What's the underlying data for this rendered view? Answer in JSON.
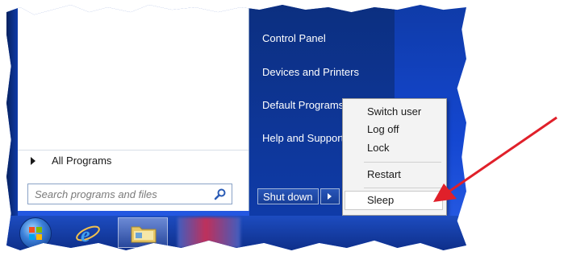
{
  "start_menu": {
    "left_pane": {
      "all_programs_label": "All Programs",
      "search_placeholder": "Search programs and files"
    },
    "right_pane": {
      "items": [
        {
          "label": "Control Panel"
        },
        {
          "label": "Devices and Printers"
        },
        {
          "label": "Default Programs"
        },
        {
          "label": "Help and Support"
        }
      ],
      "shutdown_label": "Shut down"
    }
  },
  "shutdown_submenu": {
    "items": [
      {
        "label": "Switch user"
      },
      {
        "label": "Log off"
      },
      {
        "label": "Lock"
      },
      {
        "label": "Restart"
      },
      {
        "label": "Sleep",
        "highlighted": true
      }
    ]
  },
  "taskbar": {
    "icons": [
      "windows-start-orb",
      "internet-explorer-icon",
      "windows-explorer-icon",
      "redacted-app"
    ]
  },
  "colors": {
    "start_menu_right": "#0f3ba8",
    "annotation_arrow": "#e0202a",
    "taskbar": "#1d4cc0"
  }
}
